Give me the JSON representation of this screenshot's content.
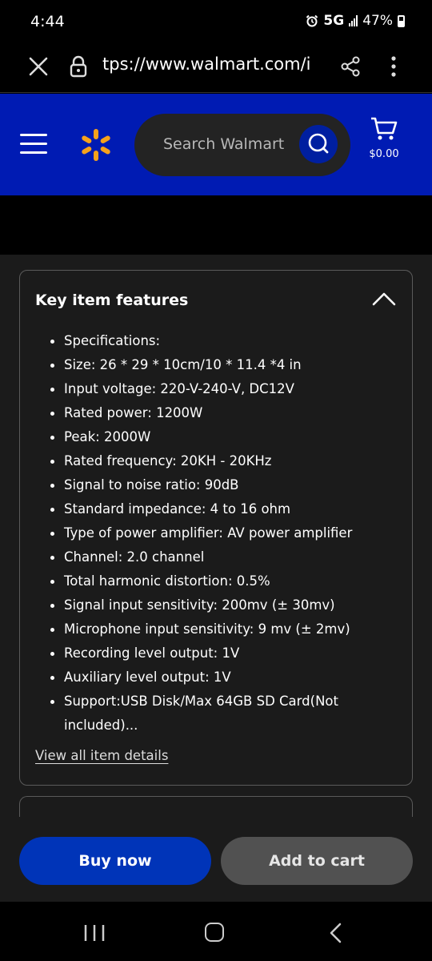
{
  "status_bar": {
    "time": "4:44",
    "network": "5G",
    "battery": "47%"
  },
  "browser": {
    "url": "tps://www.walmart.com/i"
  },
  "header": {
    "search_placeholder": "Search Walmart",
    "cart_total": "$0.00",
    "brand_color": "#001bb3",
    "spark_color": "#f7a21b"
  },
  "features": {
    "title": "Key item features",
    "items": [
      "Specifications:",
      "Size: 26 * 29 * 10cm/10 * 11.4 *4 in",
      "Input voltage: 220-V-240-V, DC12V",
      "Rated power: 1200W",
      "Peak: 2000W",
      "Rated frequency: 20KH - 20KHz",
      "Signal to noise ratio: 90dB",
      "Standard impedance: 4 to 16 ohm",
      "Type of power amplifier: AV power amplifier",
      "Channel: 2.0 channel",
      "Total harmonic distortion: 0.5%",
      "Signal input sensitivity: 200mv (± 30mv)",
      "Microphone input sensitivity: 9 mv (± 2mv)",
      "Recording level output: 1V",
      "Auxiliary level output: 1V",
      "Support:USB Disk/Max 64GB SD Card(Not included)..."
    ],
    "view_all_label": "View all item details"
  },
  "actions": {
    "buy_now_label": "Buy now",
    "add_to_cart_label": "Add to cart"
  }
}
